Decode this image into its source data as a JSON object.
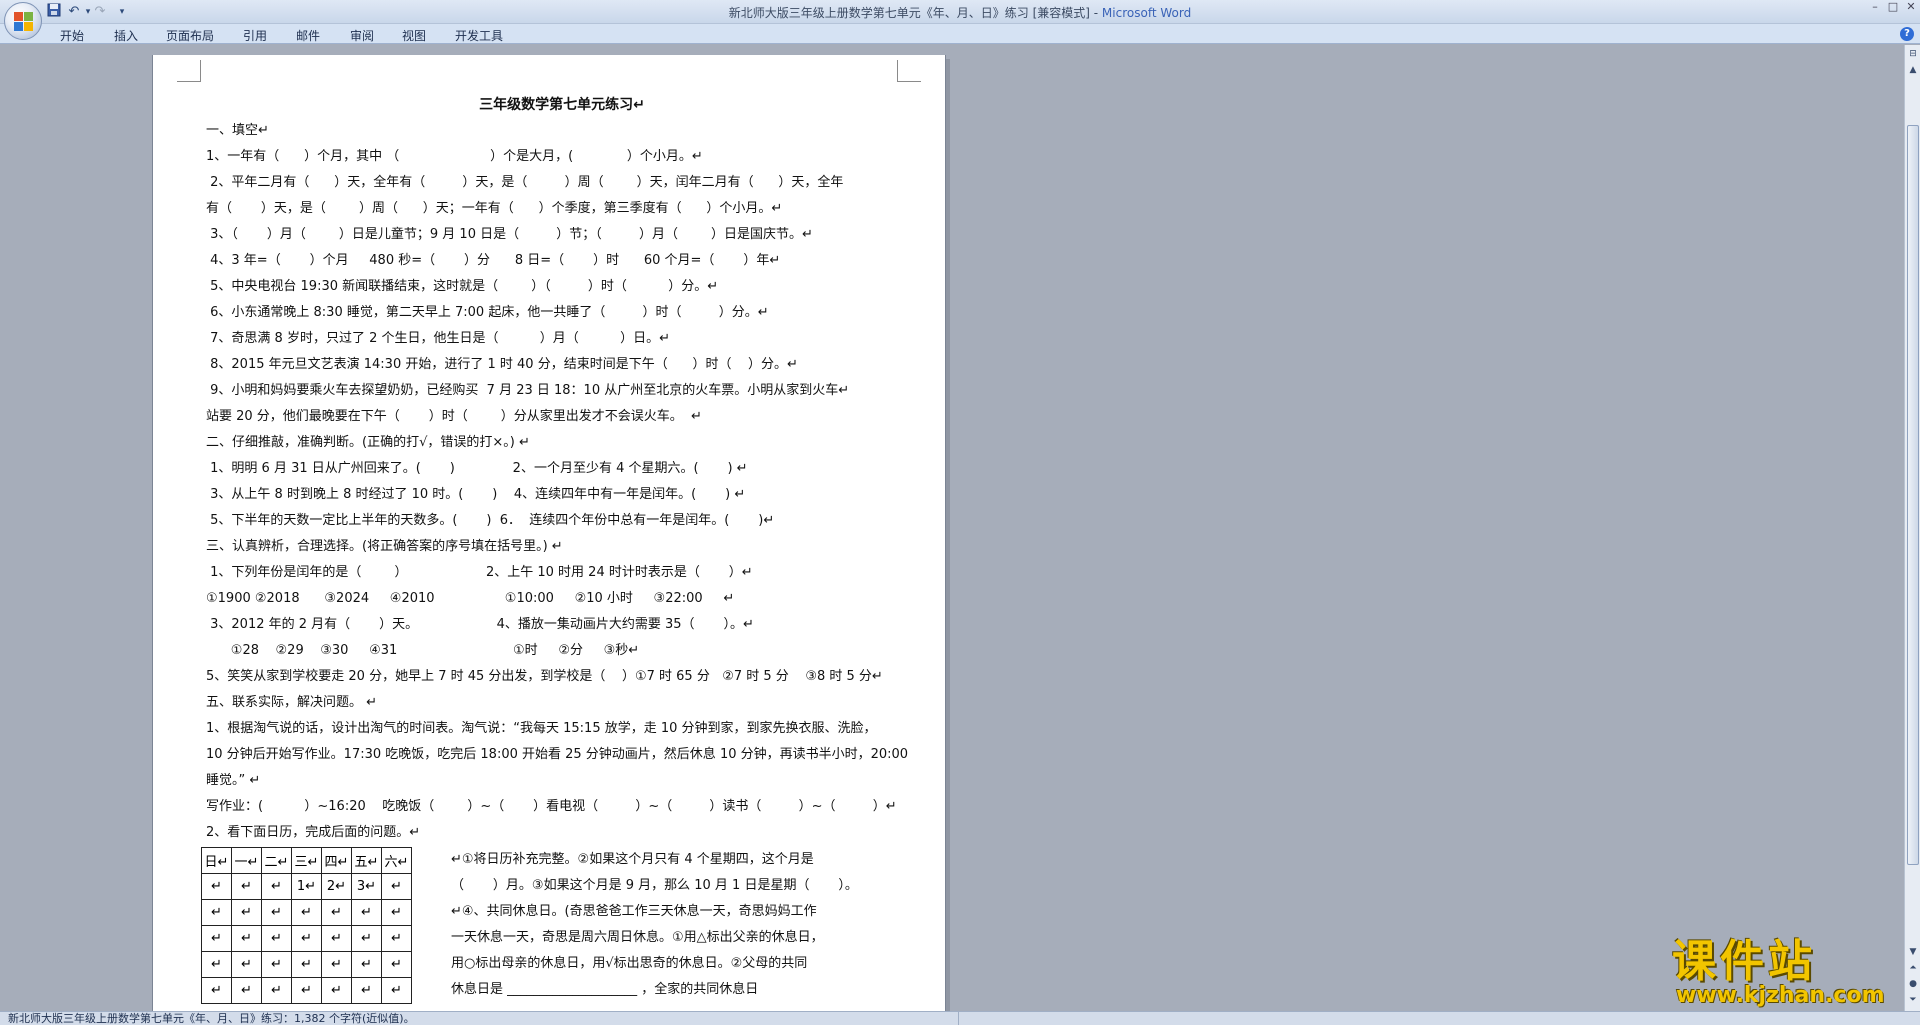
{
  "window": {
    "title_doc": "新北师大版三年级上册数学第七单元《年、月、日》练习 [兼容模式] - ",
    "title_app": "Microsoft Word",
    "minimize": "–",
    "maximize": "□",
    "close": "✕"
  },
  "quick_access": {
    "save_icon": "save-icon",
    "undo_icon": "undo-icon",
    "redo_icon": "redo-icon",
    "undo_glyph": "↶",
    "redo_glyph": "↷",
    "more_glyph": "▾"
  },
  "ribbon": {
    "tabs": [
      "开始",
      "插入",
      "页面布局",
      "引用",
      "邮件",
      "审阅",
      "视图",
      "开发工具"
    ],
    "help": "?"
  },
  "document": {
    "title": "三年级数学第七单元练习↵",
    "lines": [
      "一、填空↵",
      "1、一年有（      ）个月，其中 （                      ）个是大月，(             ）个小月。↵",
      " 2、平年二月有（      ）天，全年有（         ）天，是（         ）周（        ）天，闰年二月有（      ）天，全年",
      "有（       ）天，是（        ）周（      ）天；一年有（      ）个季度，第三季度有（      ）个小月。↵",
      " 3、（       ）月（        ）日是儿童节；9 月 10 日是（         ）节；（         ）月（        ）日是国庆节。↵",
      " 4、3 年=（       ）个月     480 秒=（       ）分      8 日=（       ）时      60 个月=（       ）年↵",
      " 5、中央电视台 19:30 新闻联播结束，这时就是（        ）（         ）时（          ）分。↵",
      " 6、小东通常晚上 8:30 睡觉，第二天早上 7:00 起床，他一共睡了（         ）时（         ）分。↵",
      " 7、奇思满 8 岁时，只过了 2 个生日，他生日是（          ）月（          ）日。↵",
      " 8、2015 年元旦文艺表演 14:30 开始，进行了 1 时 40 分，结束时间是下午（      ）时（    ）分。↵",
      " 9、小明和妈妈要乘火车去探望奶奶，已经购买  7 月 23 日 18：10 从广州至北京的火车票。小明从家到火车↵",
      "站要 20 分，他们最晚要在下午（       ）时（        ）分从家里出发才不会误火车。  ↵",
      "二、仔细推敲，准确判断。(正确的打√，错误的打×。) ↵",
      " 1、明明 6 月 31 日从广州回来了。(       )              2、一个月至少有 4 个星期六。(       ) ↵",
      " 3、从上午 8 时到晚上 8 时经过了 10 时。(       )    4、连续四年中有一年是闰年。(       ) ↵",
      " 5、下半年的天数一定比上半年的天数多。(       )  6．  连续四个年份中总有一年是闰年。(       )↵",
      "三、认真辨析，合理选择。(将正确答案的序号填在括号里。) ↵",
      " 1、下列年份是闰年的是（        ）                   2、上午 10 时用 24 时计时表示是（       ）↵",
      "①1900 ②2018      ③2024     ④2010                 ①10:00     ②10 小时     ③22:00     ↵",
      " 3、2012 年的 2 月有（       ）天。                   4、播放一集动画片大约需要 35（       ）。↵",
      "      ①28    ②29    ③30     ④31                            ①时     ②分     ③秒↵",
      "5、笑笑从家到学校要走 20 分，她早上 7 时 45 分出发，到学校是（    ）①7 时 65 分   ②7 时 5 分    ③8 时 5 分↵",
      "五、联系实际，解决问题。 ↵",
      "1、根据淘气说的话，设计出淘气的时间表。淘气说：“我每天 15:15 放学，走 10 分钟到家，到家先换衣服、洗脸，",
      "10 分钟后开始写作业。17:30 吃晚饭，吃完后 18:00 开始看 25 分钟动画片，然后休息 10 分钟，再读书半小时，20:00",
      "睡觉。” ↵",
      "写作业：(          ）~16:20    吃晚饭（        ）~（       ）看电视（         ）~（         ）读书（         ）~（         ）↵",
      "2、看下面日历，完成后面的问题。↵"
    ],
    "calendar": {
      "header": [
        "日↵",
        "一↵",
        "二↵",
        "三↵",
        "四↵",
        "五↵",
        "六↵"
      ],
      "rows": [
        [
          "↵",
          "↵",
          "↵",
          "1↵",
          "2↵",
          "3↵",
          "↵"
        ],
        [
          "↵",
          "↵",
          "↵",
          "↵",
          "↵",
          "↵",
          "↵"
        ],
        [
          "↵",
          "↵",
          "↵",
          "↵",
          "↵",
          "↵",
          "↵"
        ],
        [
          "↵",
          "↵",
          "↵",
          "↵",
          "↵",
          "↵",
          "↵"
        ],
        [
          "↵",
          "↵",
          "↵",
          "↵",
          "↵",
          "↵",
          "↵"
        ]
      ]
    },
    "calendar_text": [
      "↵①将日历补充完整。②如果这个月只有 4 个星期四，这个月是",
      "（       ）月。③如果这个月是 9 月，那么 10 月 1 日是星期（       ）。",
      "↵④、共同休息日。(奇思爸爸工作三天休息一天，奇思妈妈工作",
      "一天休息一天，奇思是周六周日休息。①用△标出父亲的休息日，",
      "用○标出母亲的休息日，用√标出思奇的休息日。②父母的共同",
      "休息日是 ____________________ ，全家的共同休息日"
    ]
  },
  "statusbar": {
    "text": "新北师大版三年级上册数学第七单元《年、月、日》练习：1,382 个字符(近似值)。"
  },
  "watermark": {
    "big": "课件站",
    "url": "www.kjzhan.com"
  },
  "colors": {
    "app_accent": "#3a63b7",
    "watermark": "#f2c500",
    "doc_background": "#a6adba"
  }
}
